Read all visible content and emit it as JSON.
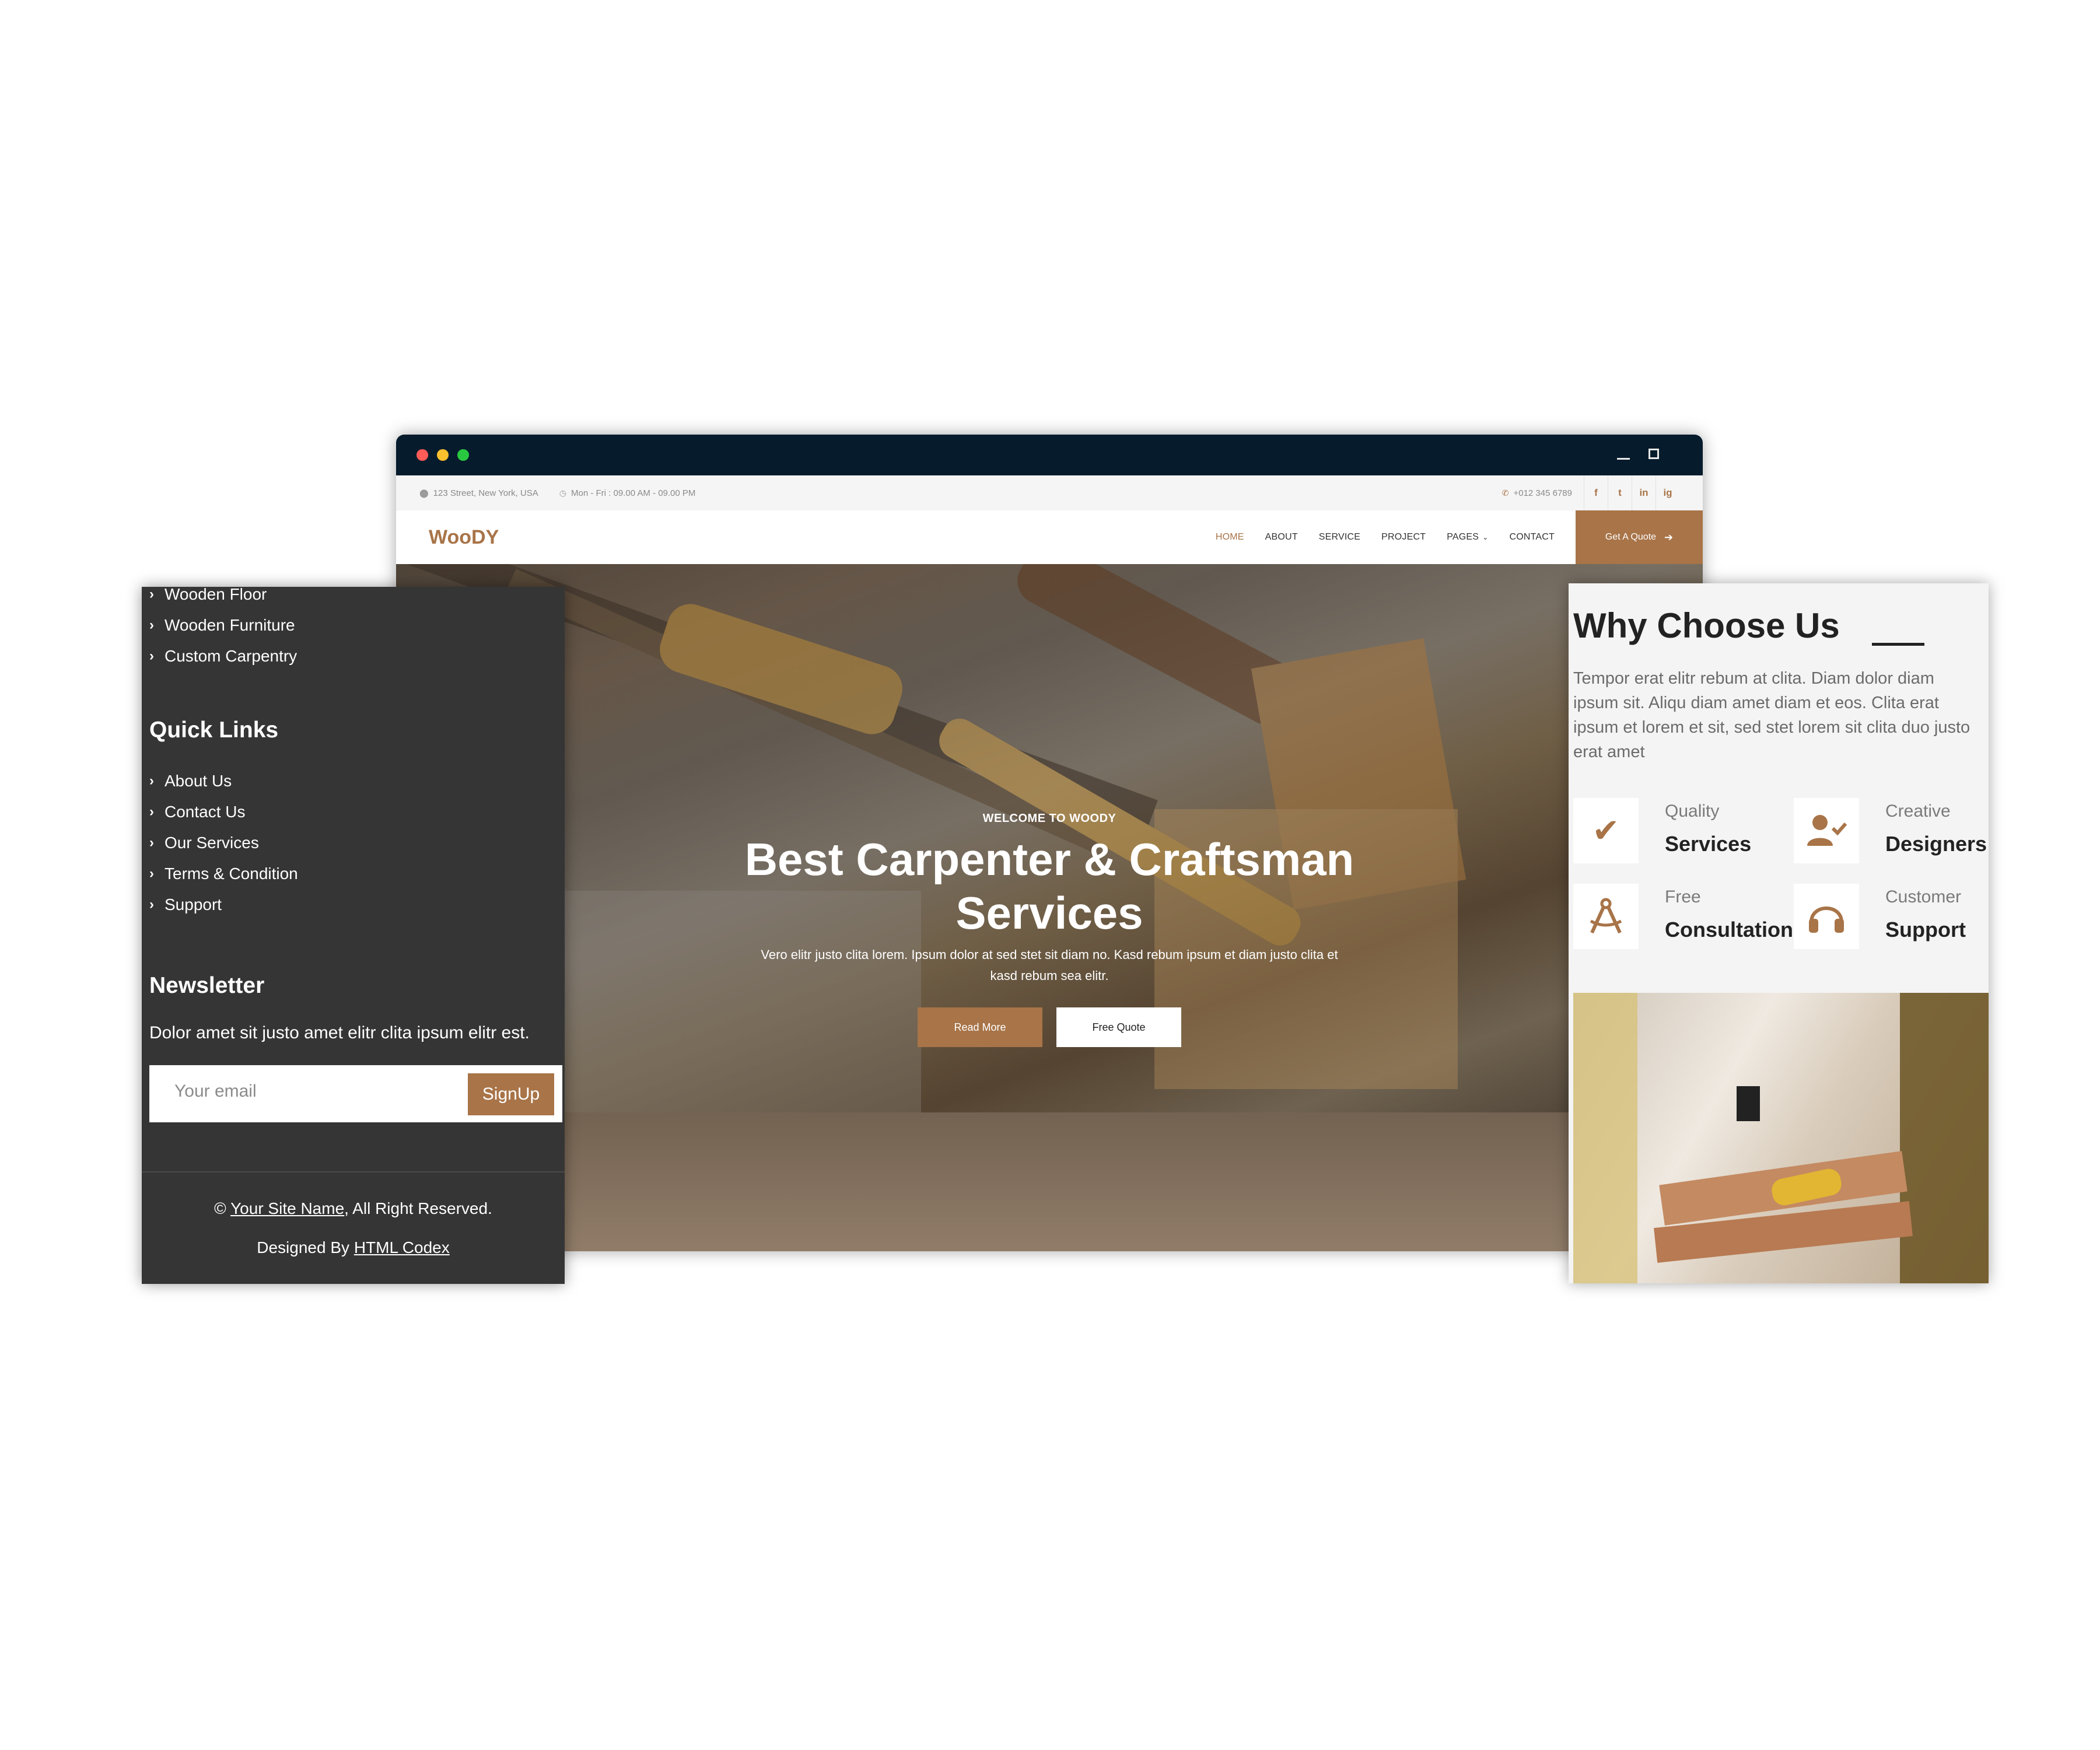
{
  "browser": {
    "topbar": {
      "address": "123 Street, New York, USA",
      "hours": "Mon - Fri : 09.00 AM - 09.00 PM",
      "phone": "+012 345 6789",
      "social": [
        "f",
        "t",
        "in",
        "ig"
      ]
    },
    "navbar": {
      "logo": "WooDY",
      "links": [
        "HOME",
        "ABOUT",
        "SERVICE",
        "PROJECT",
        "PAGES",
        "CONTACT"
      ],
      "active": "HOME",
      "cta": "Get A Quote"
    },
    "hero": {
      "eyebrow": "WELCOME TO WOODY",
      "headline_line1": "Best Carpenter & Craftsman",
      "headline_line2": "Services",
      "description": "Vero elitr justo clita lorem. Ipsum dolor at sed stet sit diam no. Kasd rebum ipsum et diam justo clita et kasd rebum sea elitr.",
      "primary_button": "Read More",
      "secondary_button": "Free Quote"
    }
  },
  "footer": {
    "services": [
      "Wooden Floor",
      "Wooden Furniture",
      "Custom Carpentry"
    ],
    "quick_links_title": "Quick Links",
    "quick_links": [
      "About Us",
      "Contact Us",
      "Our Services",
      "Terms & Condition",
      "Support"
    ],
    "newsletter_title": "Newsletter",
    "newsletter_text": "Dolor amet sit justo amet elitr clita ipsum elitr est.",
    "email_placeholder": "Your email",
    "signup_button": "SignUp",
    "copyright_prefix": "©",
    "site_name": "Your Site Name",
    "copyright_suffix": ", All Right Reserved.",
    "designed_prefix": "Designed By",
    "designer": "HTML Codex"
  },
  "why_choose": {
    "title": "Why Choose Us",
    "text": "Tempor erat elitr rebum at clita. Diam dolor diam ipsum sit. Aliqu diam amet diam et eos. Clita erat ipsum et lorem et sit, sed stet lorem sit clita duo justo erat amet",
    "features": [
      {
        "sub": "Quality",
        "main": "Services",
        "icon": "check-icon"
      },
      {
        "sub": "Creative",
        "main": "Designers",
        "icon": "user-check-icon"
      },
      {
        "sub": "Free",
        "main": "Consultation",
        "icon": "drafting-compass-icon"
      },
      {
        "sub": "Customer",
        "main": "Support",
        "icon": "headphones-icon"
      }
    ]
  },
  "colors": {
    "accent": "#a87448",
    "dark_panel": "#353535",
    "titlebar": "#061b2c"
  }
}
